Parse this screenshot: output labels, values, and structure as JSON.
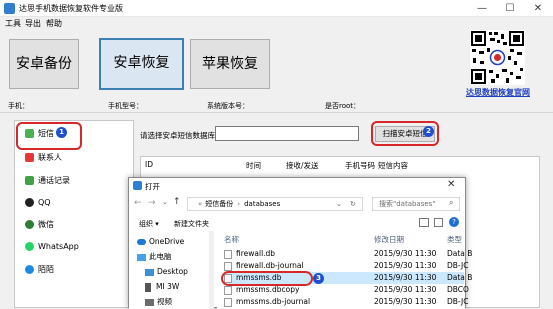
{
  "window": {
    "title": "达思手机数据恢复软件专业版",
    "controls": {
      "minimize": "—",
      "maximize": "☐",
      "close": "✕"
    }
  },
  "menu": [
    "工具",
    "导出",
    "帮助"
  ],
  "main_buttons": [
    {
      "label": "安卓备份",
      "active": false
    },
    {
      "label": "安卓恢复",
      "active": true
    },
    {
      "label": "苹果恢复",
      "active": false
    }
  ],
  "brand_link": "达思数据恢复官网",
  "device_info": {
    "phone_label": "手机：",
    "model_label": "手机型号：",
    "version_label": "系统版本号：",
    "root_label": "是否root："
  },
  "left_list": [
    {
      "label": "短信",
      "color": "#4caf50"
    },
    {
      "label": "联系人",
      "color": "#e53935"
    },
    {
      "label": "通话记录",
      "color": "#43a047"
    },
    {
      "label": "QQ",
      "color": "#212121"
    },
    {
      "label": "微信",
      "color": "#2e7d32"
    },
    {
      "label": "WhatsApp",
      "color": "#25d366"
    },
    {
      "label": "陌陌",
      "color": "#1e88e5"
    }
  ],
  "db_select": {
    "label": "请选择安卓短信数据库：",
    "value": ""
  },
  "scan_button": "扫描安卓短信",
  "grid_headers": [
    "ID",
    "时间",
    "接收/发送",
    "手机号码",
    "短信内容"
  ],
  "badges": [
    "1",
    "2",
    "3"
  ],
  "dialog": {
    "title": "打开",
    "breadcrumb": [
      "短信备份",
      "databases"
    ],
    "search_placeholder": "搜索\"databases\"",
    "toolbar": {
      "organize": "组织 ▾",
      "new_folder": "新建文件夹"
    },
    "nav": [
      "OneDrive",
      "此电脑",
      "Desktop",
      "MI 3W",
      "视频"
    ],
    "columns": {
      "name": "名称",
      "date": "修改日期",
      "type": "类型"
    },
    "files": [
      {
        "name": "firewall.db",
        "date": "2015/9/30 11:30",
        "type": "Data B",
        "selected": false
      },
      {
        "name": "firewall.db-journal",
        "date": "2015/9/30 11:30",
        "type": "DB-JC",
        "selected": false
      },
      {
        "name": "mmssms.db",
        "date": "2015/9/30 11:30",
        "type": "Data B",
        "selected": true
      },
      {
        "name": "mmssms.dbcopy",
        "date": "2015/9/30 11:30",
        "type": "DBCO",
        "selected": false
      },
      {
        "name": "mmssms.db-journal",
        "date": "2015/9/30 11:30",
        "type": "DB-JC",
        "selected": false
      }
    ]
  },
  "colors": {
    "accent": "#3c7fb1",
    "annotation_red": "#d62828",
    "badge_blue": "#1f4fd1",
    "brand_blue": "#1f3fbf"
  }
}
